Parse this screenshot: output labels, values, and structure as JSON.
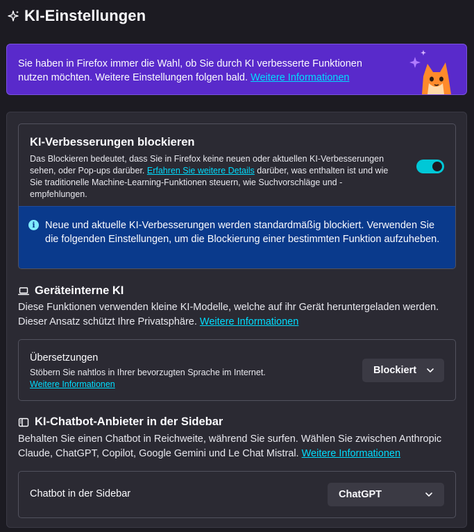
{
  "header": {
    "title": "KI-Einstellungen",
    "icon": "sparkle-icon"
  },
  "promo": {
    "text": "Sie haben in Firefox immer die Wahl, ob Sie durch KI verbesserte Funktionen nutzen möchten. Weitere Einstellungen folgen bald.",
    "link": "Weitere Informationen",
    "art": "firefox-fox-illustration"
  },
  "block": {
    "title": "KI-Verbesserungen blockieren",
    "desc_before": "Das Blockieren bedeutet, dass Sie in Firefox keine neuen oder aktuellen KI-Verbesserungen sehen, oder Pop-ups darüber. ",
    "desc_link": "Erfahren Sie weitere Details",
    "desc_after": " darüber, was enthalten ist und wie Sie traditionelle Machine-Learning-Funktionen steuern, wie Suchvorschläge und -empfehlungen.",
    "toggle_on": true,
    "info": "Neue und aktuelle KI-Verbesserungen werden standardmäßig blockiert. Verwenden Sie die folgenden Einstellungen, um die Blockierung einer bestimmten Funktion aufzuheben."
  },
  "ondevice": {
    "title": "Geräteinterne KI",
    "icon": "laptop-icon",
    "desc": "Diese Funktionen verwenden kleine KI-Modelle, welche auf ihr Gerät heruntergeladen werden. Dieser Ansatz schützt Ihre Privatsphäre. ",
    "link": "Weitere Informationen",
    "translations": {
      "label": "Übersetzungen",
      "sub": "Stöbern Sie nahtlos in Ihrer bevorzugten Sprache im Internet.",
      "link": "Weitere Informationen",
      "value": "Blockiert"
    }
  },
  "chatbot": {
    "title": "KI-Chatbot-Anbieter in der Sidebar",
    "icon": "sidebar-icon",
    "desc": "Behalten Sie einen Chatbot in Reichweite, während Sie surfen. Wählen Sie zwischen Anthropic Claude, ChatGPT, Copilot, Google Gemini und Le Chat Mistral. ",
    "link": "Weitere Informationen",
    "row_label": "Chatbot in der Sidebar",
    "value": "ChatGPT"
  },
  "colors": {
    "background": "#1c1b22",
    "card": "#2b2a33",
    "promo": "#592acb",
    "info": "#0a3a8c",
    "accent": "#00ddff",
    "toggle": "#00c8d7"
  }
}
